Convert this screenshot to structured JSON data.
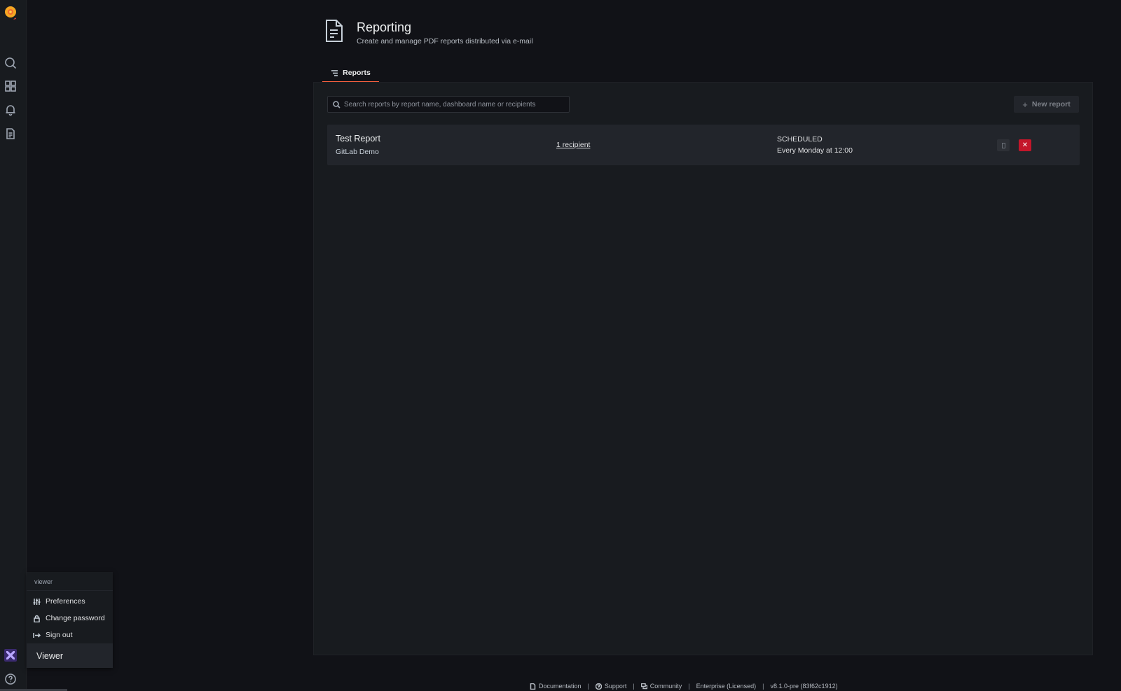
{
  "sidebar": {
    "icons": [
      "grafana-logo-icon",
      "search-icon",
      "dashboards-icon",
      "alerting-icon",
      "reporting-icon",
      "user-avatar-icon",
      "help-icon"
    ]
  },
  "profile_menu": {
    "username": "viewer",
    "items": [
      {
        "label": "Preferences",
        "icon": "sliders-icon"
      },
      {
        "label": "Change password",
        "icon": "lock-icon"
      },
      {
        "label": "Sign out",
        "icon": "sign-out-icon"
      }
    ],
    "display_name": "Viewer"
  },
  "header": {
    "title": "Reporting",
    "subtitle": "Create and manage PDF reports distributed via e-mail"
  },
  "tabs": [
    {
      "label": "Reports",
      "active": true
    }
  ],
  "toolbar": {
    "search_placeholder": "Search reports by report name, dashboard name or recipients",
    "new_report_label": "New report"
  },
  "reports": [
    {
      "name": "Test Report",
      "dashboard": "GitLab Demo",
      "recipients": "1 recipient",
      "state": "SCHEDULED",
      "schedule": "Every Monday at 12:00"
    }
  ],
  "footer": {
    "documentation": "Documentation",
    "support": "Support",
    "community": "Community",
    "edition": "Enterprise (Licensed)",
    "version": "v8.1.0-pre (83f62c1912)"
  },
  "colors": {
    "accent": "#f55f3e",
    "delete": "#c4162a",
    "background": "#111217",
    "panel": "#181b1f"
  }
}
